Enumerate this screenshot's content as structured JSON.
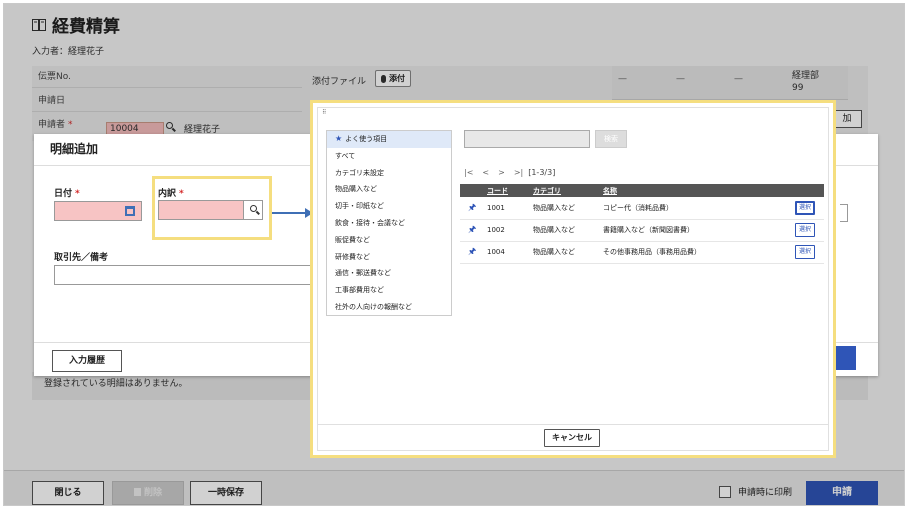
{
  "page": {
    "title": "経費精算",
    "applicant_label": "入力者：経理花子"
  },
  "bg_form": {
    "slip_no": "伝票No.",
    "apply_date": "申請日",
    "applicant": "申請者",
    "applicant_required": "*",
    "employee_code": "10004",
    "employee_name": "経理花子",
    "attach_label": "添付ファイル",
    "attach_button": "添付",
    "col_1": "—",
    "col_2": "—",
    "col_3": "—",
    "dept_line1": "経理部",
    "dept_line2": "99",
    "add_button": "加",
    "empty_message": "登録されている明細はありません。"
  },
  "detail_dialog": {
    "title": "明細追加",
    "date_label": "日付",
    "item_label": "内訳",
    "required_mark": "*",
    "memo_label": "取引先／備考",
    "history_button": "入力履歴"
  },
  "picker": {
    "categories": [
      "よく使う項目",
      "すべて",
      "カテゴリ未設定",
      "物品購入など",
      "切手・印紙など",
      "飲食・接待・会議など",
      "販促費など",
      "研修費など",
      "通信・郵送費など",
      "工事部費用など",
      "社外の人向けの報酬など"
    ],
    "search_button": "検索",
    "pager": {
      "first": "|<",
      "prev": "<",
      "next": ">",
      "last": ">|",
      "count": "[1-3/3]"
    },
    "columns": {
      "code": "コード",
      "category": "カテゴリ",
      "name": "名称"
    },
    "rows": [
      {
        "code": "1001",
        "category": "物品購入など",
        "name": "コピー代（消耗品費）",
        "select": "選択"
      },
      {
        "code": "1002",
        "category": "物品購入など",
        "name": "書籍購入など（新聞図書費）",
        "select": "選択"
      },
      {
        "code": "1004",
        "category": "物品購入など",
        "name": "その他事務用品（事務用品費）",
        "select": "選択"
      }
    ],
    "cancel_button": "キャンセル"
  },
  "bottom_bar": {
    "close_button": "閉じる",
    "delete_button": "削除",
    "save_button": "一時保存",
    "print_label": "申請時に印刷",
    "apply_button": "申請"
  },
  "colors": {
    "accent": "#2f55b7",
    "highlight": "#f5de7f",
    "required_bg": "#f7c4c4"
  }
}
